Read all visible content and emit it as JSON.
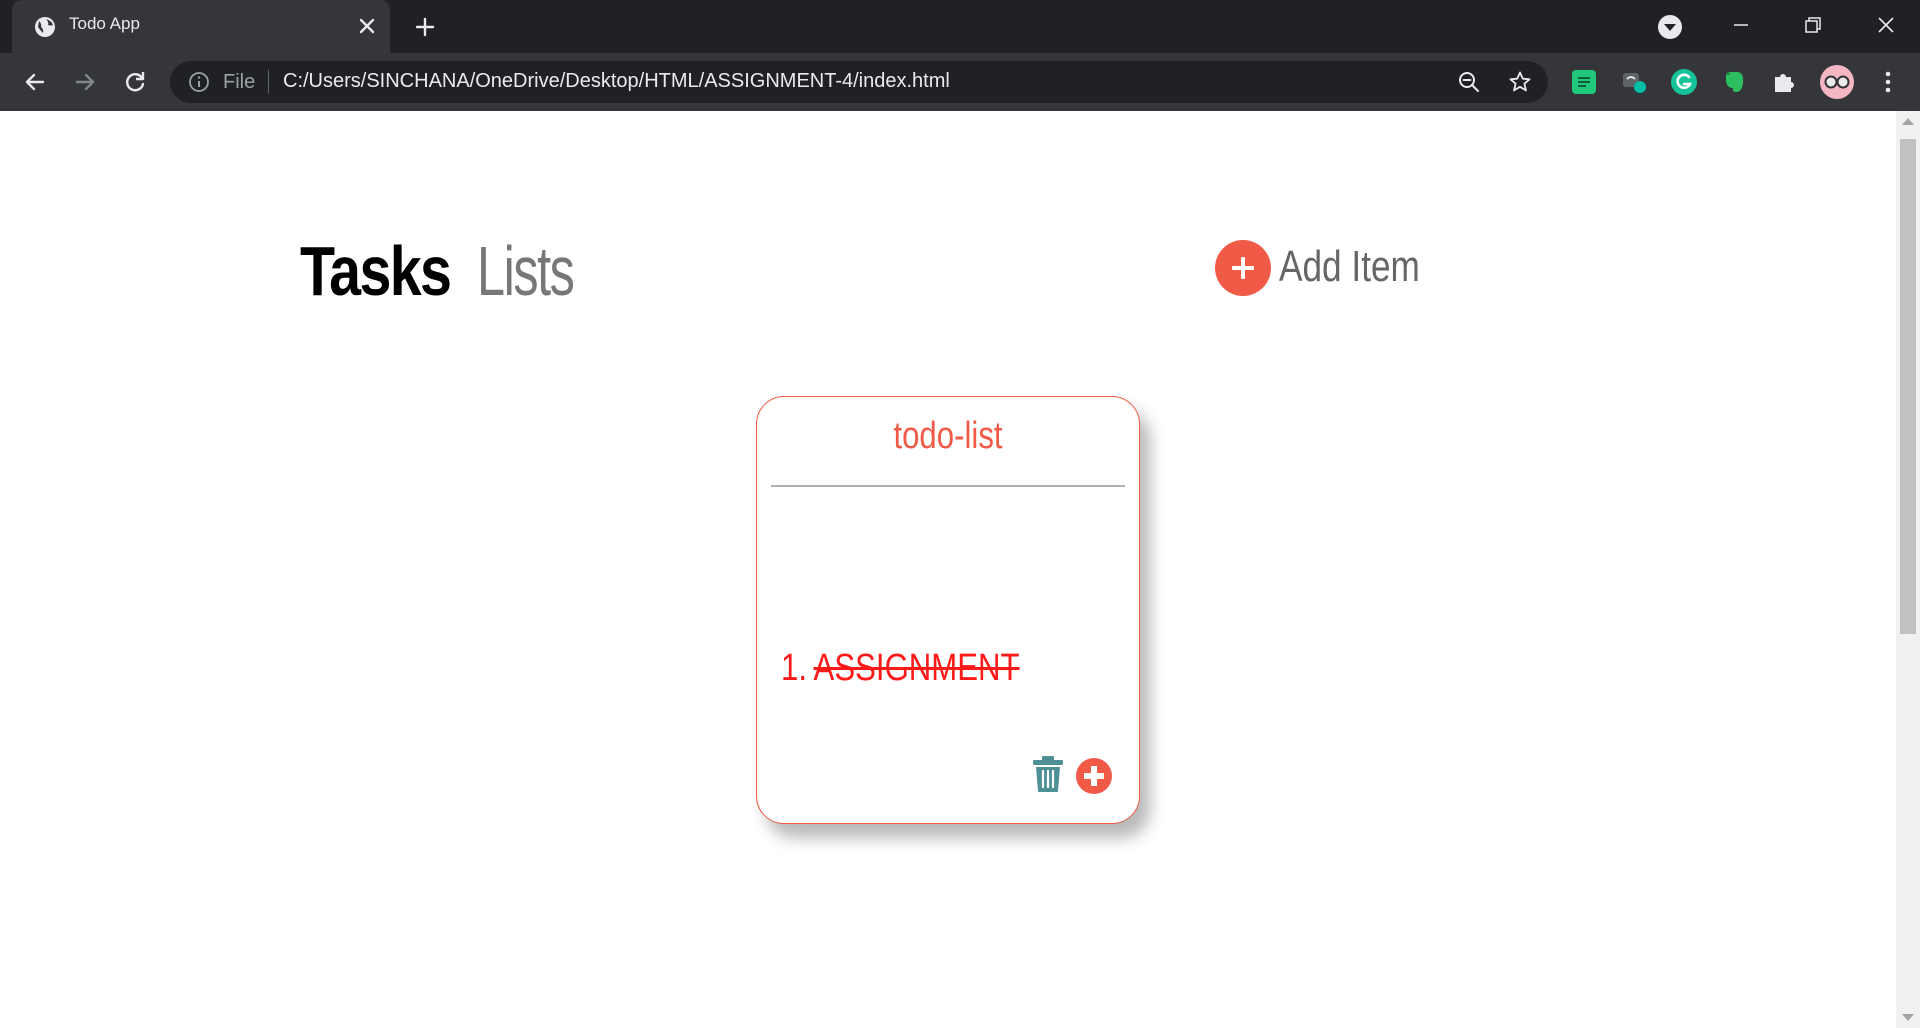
{
  "browser": {
    "tab_title": "Todo App",
    "scheme_label": "File",
    "url": "C:/Users/SINCHANA/OneDrive/Desktop/HTML/ASSIGNMENT-4/index.html",
    "icons": [
      "globe-icon",
      "close-icon",
      "plus-icon",
      "dropdown-icon",
      "minimize-icon",
      "restore-icon",
      "close-window-icon",
      "back-icon",
      "forward-icon",
      "reload-icon",
      "info-icon",
      "zoom-out-icon",
      "star-icon",
      "menu-icon"
    ],
    "extensions": [
      "spreadsheet-extension-icon",
      "meet-extension-icon",
      "grammarly-icon",
      "evernote-icon",
      "puzzle-icon",
      "profile-avatar"
    ]
  },
  "app": {
    "nav": {
      "tasks": "Tasks",
      "lists": "Lists"
    },
    "add_item_label": "Add Item",
    "card": {
      "title": "todo-list",
      "items": [
        {
          "number": "1.",
          "text": "ASSIGNMENT",
          "completed": true
        }
      ]
    },
    "colors": {
      "accent": "#f05a47",
      "completed_text": "#ff1a1a",
      "trash": "#4f8f96"
    }
  }
}
